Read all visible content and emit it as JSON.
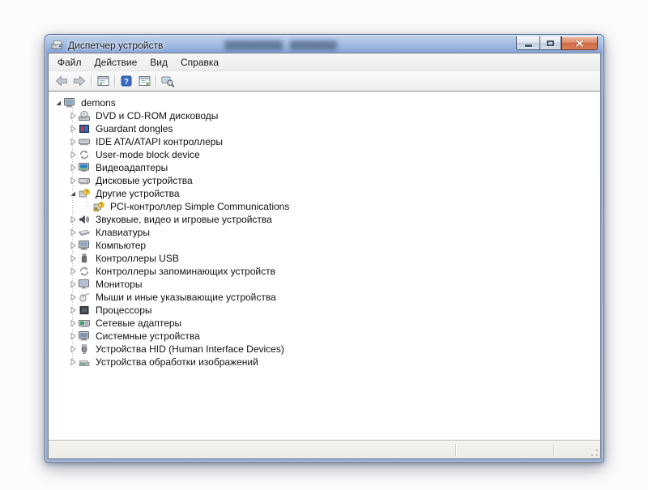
{
  "window": {
    "title": "Диспетчер устройств",
    "caption_buttons": [
      "minimize",
      "maximize",
      "close"
    ]
  },
  "menubar": {
    "items": [
      "Файл",
      "Действие",
      "Вид",
      "Справка"
    ]
  },
  "toolbar": {
    "buttons": [
      {
        "icon": "back-arrow"
      },
      {
        "icon": "forward-arrow"
      },
      {
        "icon": "separator"
      },
      {
        "icon": "console-tree"
      },
      {
        "icon": "separator"
      },
      {
        "icon": "help"
      },
      {
        "icon": "action-pane"
      },
      {
        "icon": "separator"
      },
      {
        "icon": "scan-hardware"
      }
    ]
  },
  "tree": {
    "items": [
      {
        "label": "demons",
        "level": 0,
        "expander": "expanded",
        "icon": "computer"
      },
      {
        "label": "DVD и CD-ROM дисководы",
        "level": 1,
        "expander": "collapsed",
        "icon": "dvd-drive"
      },
      {
        "label": "Guardant dongles",
        "level": 1,
        "expander": "collapsed",
        "icon": "dongle"
      },
      {
        "label": "IDE ATA/ATAPI контроллеры",
        "level": 1,
        "expander": "collapsed",
        "icon": "ide-controller"
      },
      {
        "label": "User-mode block device",
        "level": 1,
        "expander": "collapsed",
        "icon": "block-device"
      },
      {
        "label": "Видеоадаптеры",
        "level": 1,
        "expander": "collapsed",
        "icon": "video-adapter"
      },
      {
        "label": "Дисковые устройства",
        "level": 1,
        "expander": "collapsed",
        "icon": "disk-drive"
      },
      {
        "label": "Другие устройства",
        "level": 1,
        "expander": "expanded",
        "icon": "unknown-device"
      },
      {
        "label": "PCI-контроллер Simple Communications",
        "level": 2,
        "expander": "none",
        "icon": "unknown-device-warning"
      },
      {
        "label": "Звуковые, видео и игровые устройства",
        "level": 1,
        "expander": "collapsed",
        "icon": "audio-device"
      },
      {
        "label": "Клавиатуры",
        "level": 1,
        "expander": "collapsed",
        "icon": "keyboard"
      },
      {
        "label": "Компьютер",
        "level": 1,
        "expander": "collapsed",
        "icon": "computer"
      },
      {
        "label": "Контроллеры USB",
        "level": 1,
        "expander": "collapsed",
        "icon": "usb-controller"
      },
      {
        "label": "Контроллеры запоминающих устройств",
        "level": 1,
        "expander": "collapsed",
        "icon": "storage-controller"
      },
      {
        "label": "Мониторы",
        "level": 1,
        "expander": "collapsed",
        "icon": "monitor"
      },
      {
        "label": "Мыши и иные указывающие устройства",
        "level": 1,
        "expander": "collapsed",
        "icon": "mouse"
      },
      {
        "label": "Процессоры",
        "level": 1,
        "expander": "collapsed",
        "icon": "processor"
      },
      {
        "label": "Сетевые адаптеры",
        "level": 1,
        "expander": "collapsed",
        "icon": "network-adapter"
      },
      {
        "label": "Системные устройства",
        "level": 1,
        "expander": "collapsed",
        "icon": "system-device"
      },
      {
        "label": "Устройства HID (Human Interface Devices)",
        "level": 1,
        "expander": "collapsed",
        "icon": "hid-device"
      },
      {
        "label": "Устройства обработки изображений",
        "level": 1,
        "expander": "collapsed",
        "icon": "imaging-device"
      }
    ]
  },
  "colors": {
    "titlebar_blue": "#85a3d6",
    "close_button_red": "#ce6a44",
    "warning_yellow": "#ffd54a",
    "unknown_badge_yellow": "#f2c21c",
    "statusbar_gray": "#f0efe9"
  }
}
